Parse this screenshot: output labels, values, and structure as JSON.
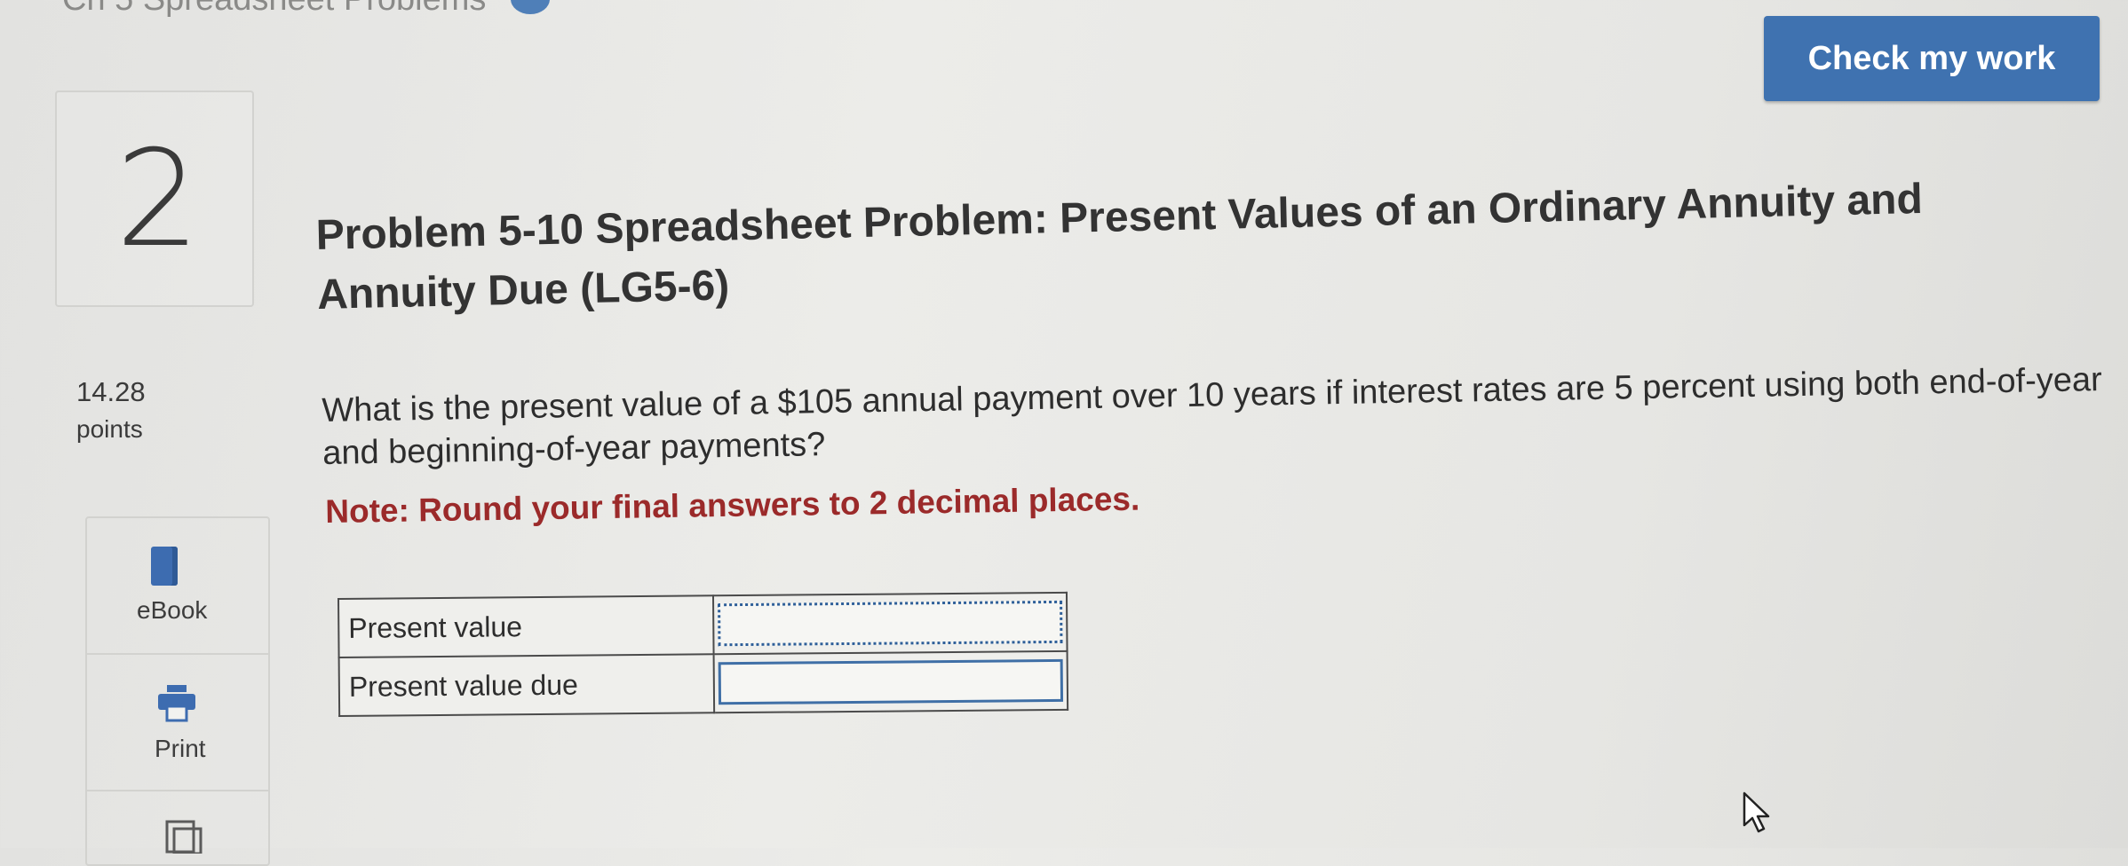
{
  "header": {
    "assignment_title": "Ch 5 Spreadsheet Problems",
    "check_button_label": "Check my work"
  },
  "question": {
    "number": "2",
    "points_value": "14.28",
    "points_label": "points",
    "title": "Problem 5-10 Spreadsheet Problem: Present Values of an Ordinary Annuity and Annuity Due (LG5-6)",
    "text": "What is the present value of a $105 annual payment over 10 years if interest rates are 5 percent using both end-of-year and beginning-of-year payments?",
    "note": "Note: Round your final answers to 2 decimal places."
  },
  "sidebar": {
    "ebook_label": "eBook",
    "print_label": "Print"
  },
  "answer_table": {
    "rows": [
      {
        "label": "Present value",
        "value": ""
      },
      {
        "label": "Present value due",
        "value": ""
      }
    ]
  },
  "colors": {
    "accent": "#3f72b0",
    "note": "#9b2a2a"
  },
  "icons": [
    "book-icon",
    "printer-icon",
    "reference-icon",
    "mouse-cursor-icon"
  ]
}
